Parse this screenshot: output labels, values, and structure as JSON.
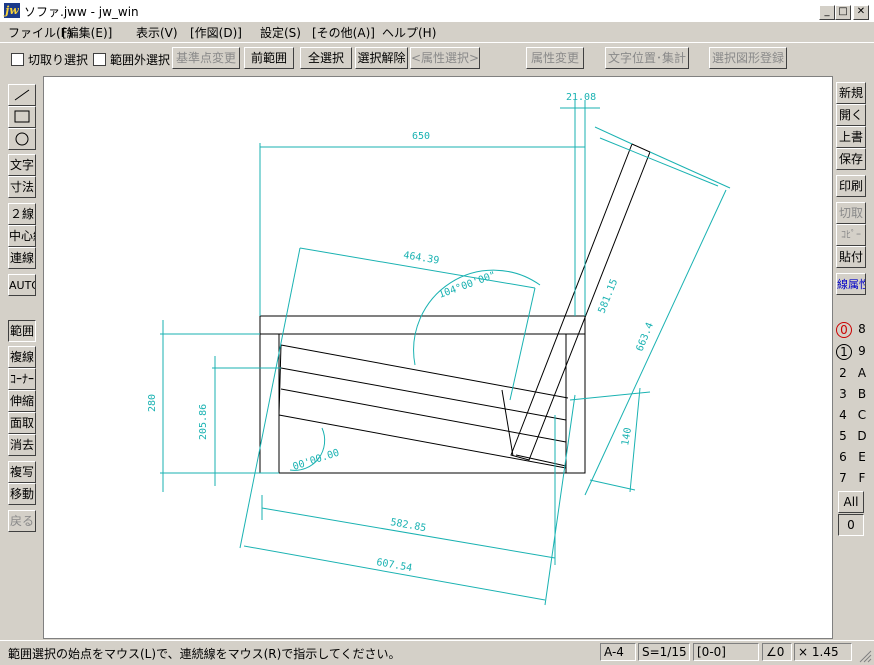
{
  "window": {
    "title": "ソファ.jww - jw_win",
    "logo": "jw",
    "minimize_icon": "minimize-icon",
    "maximize_icon": "maximize-icon",
    "close_icon": "close-icon"
  },
  "menu": [
    "ファイル(F)",
    "[編集(E)]",
    "表示(V)",
    "[作図(D)]",
    "設定(S)",
    "[その他(A)]",
    "ヘルプ(H)"
  ],
  "toolbar": {
    "checkbox_cut": "切取り選択",
    "checkbox_outside": "範囲外選択",
    "buttons": {
      "base_point": "基準点変更",
      "prev_range": "前範囲",
      "select_all": "全選択",
      "deselect": "選択解除",
      "attr_select": "<属性選択>",
      "attr_change": "属性変更",
      "text_pos": "文字位置･集計",
      "register_shape": "選択図形登録"
    }
  },
  "left_tools": {
    "line": "line-tool-icon",
    "rect": "rectangle-tool-icon",
    "circle": "circle-tool-icon",
    "text": "文字",
    "dim": "寸法",
    "double_line": "２線",
    "center_line": "中心線",
    "cont_line": "連線",
    "auto": "AUTO",
    "range": "範囲",
    "copy_line": "複線",
    "corner": "ｺｰﾅｰ",
    "stretch": "伸縮",
    "chamfer": "面取",
    "erase": "消去",
    "duplicate": "複写",
    "move": "移動",
    "undo": "戻る"
  },
  "right_tools": {
    "new": "新規",
    "open": "開く",
    "overwrite": "上書",
    "save": "保存",
    "print": "印刷",
    "cut": "切取",
    "copy": "ｺﾋﾟｰ",
    "paste": "貼付",
    "line_attr": "線属性"
  },
  "layers": {
    "left": [
      "0",
      "1",
      "2",
      "3",
      "4",
      "5",
      "6",
      "7"
    ],
    "right": [
      "8",
      "9",
      "A",
      "B",
      "C",
      "D",
      "E",
      "F"
    ],
    "all": "All",
    "group": "0"
  },
  "drawing": {
    "dims": {
      "d21": "21.08",
      "d650": "650",
      "d464": "464.39",
      "d104": "104°00'00\"",
      "d581": "581.15",
      "d663": "663.4",
      "d280": "280",
      "d205": "205.86",
      "d00": "00'00.00",
      "d140": "140",
      "d582": "582.85",
      "d607": "607.54"
    }
  },
  "status": {
    "message": "範囲選択の始点をマウス(L)で、連続線をマウス(R)で指示してください。",
    "paper": "A-4",
    "scale": "S=1/15",
    "layer": "[0-0]",
    "angle": "∠0",
    "zoom": "× 1.45"
  },
  "colors": {
    "dimension": "#1ab2b2",
    "shape": "#000000",
    "canvas": "#ffffff"
  }
}
